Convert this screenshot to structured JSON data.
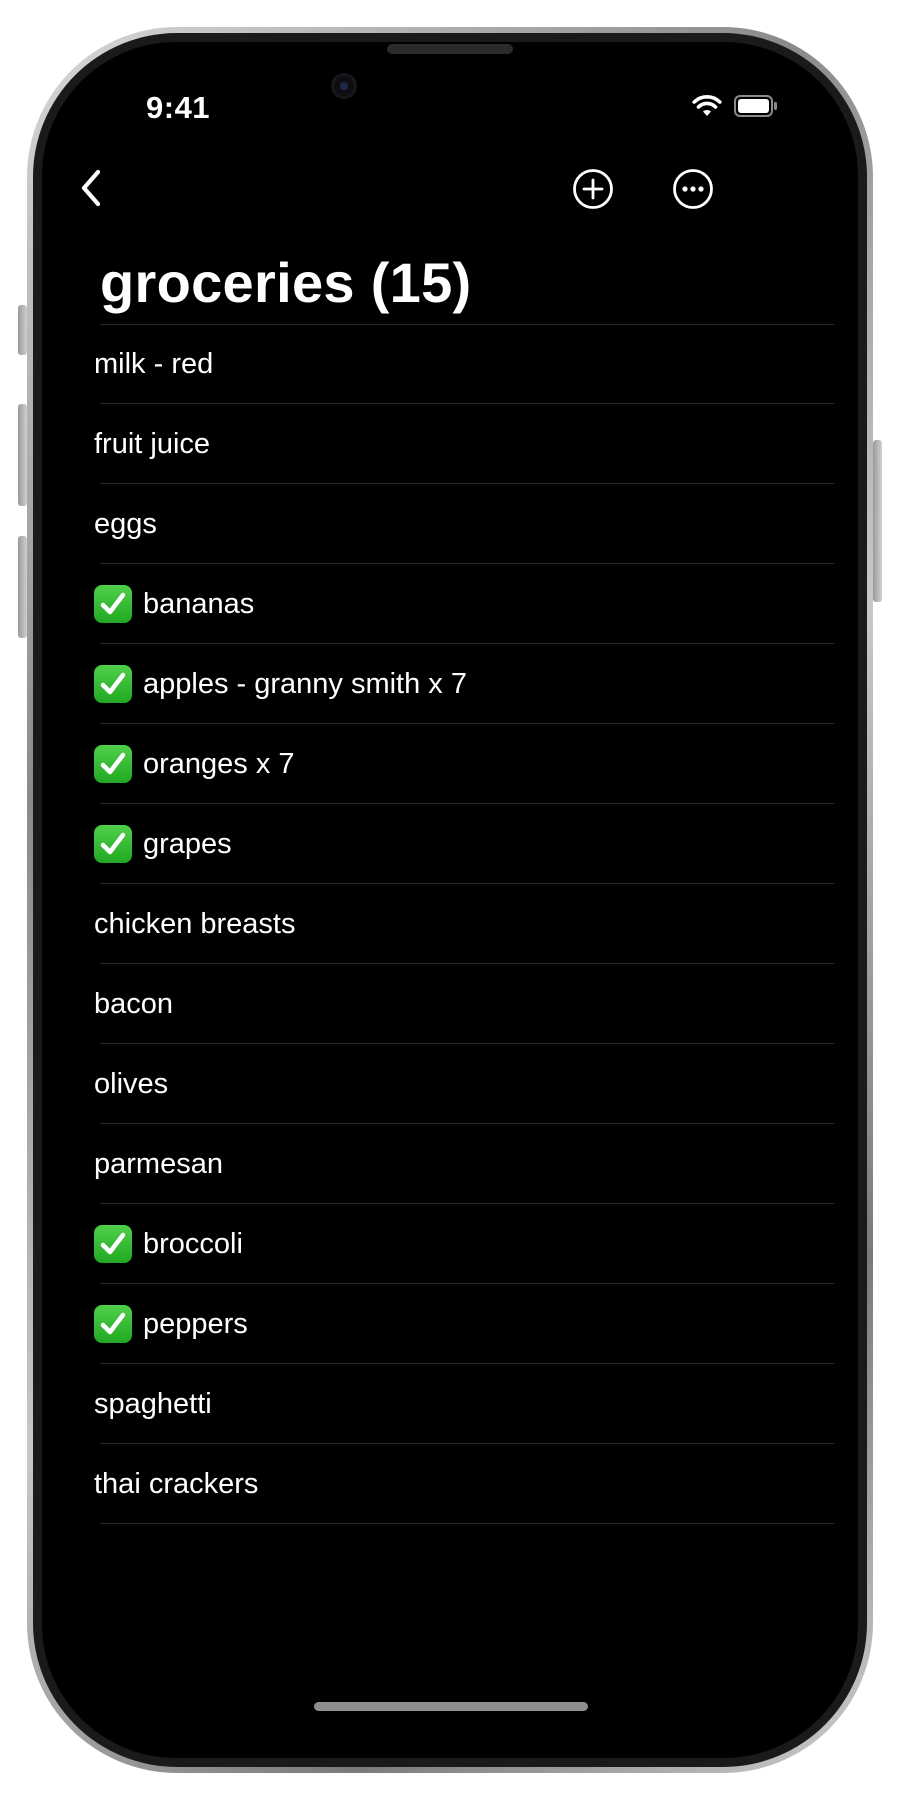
{
  "status_bar": {
    "time": "9:41",
    "icons": [
      "wifi-icon",
      "battery-icon"
    ]
  },
  "nav": {
    "back_icon": "chevron-left-icon",
    "add_icon": "plus-circle-icon",
    "more_icon": "ellipsis-circle-icon"
  },
  "list": {
    "title": "groceries (15)",
    "items": [
      {
        "label": "milk - red",
        "checked": false
      },
      {
        "label": "fruit juice",
        "checked": false
      },
      {
        "label": "eggs",
        "checked": false
      },
      {
        "label": "bananas",
        "checked": true
      },
      {
        "label": "apples - granny smith x 7",
        "checked": true
      },
      {
        "label": "oranges x 7",
        "checked": true
      },
      {
        "label": "grapes",
        "checked": true
      },
      {
        "label": "chicken breasts",
        "checked": false
      },
      {
        "label": "bacon",
        "checked": false
      },
      {
        "label": "olives",
        "checked": false
      },
      {
        "label": "parmesan",
        "checked": false
      },
      {
        "label": "broccoli",
        "checked": true
      },
      {
        "label": "peppers",
        "checked": true
      },
      {
        "label": "spaghetti",
        "checked": false
      },
      {
        "label": "thai crackers",
        "checked": false
      }
    ]
  },
  "colors": {
    "background": "#000000",
    "text": "#ffffff",
    "check": "#34c134",
    "separator": "#2a2a2a"
  }
}
